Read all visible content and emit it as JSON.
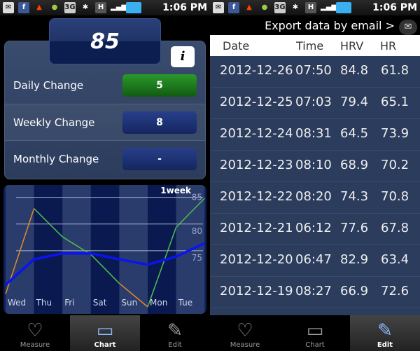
{
  "status_bar": {
    "time": "1:06 PM",
    "icons": [
      "voicemail-icon",
      "facebook-icon",
      "warning-icon",
      "android-icon",
      "3g-icon",
      "bluetooth-icon",
      "hspa-icon",
      "signal-icon",
      "battery-icon"
    ]
  },
  "left": {
    "hrv_value": "85",
    "info_label": "i",
    "rows": [
      {
        "label": "Daily Change",
        "value": "5",
        "color": "#1e7a1e"
      },
      {
        "label": "Weekly Change",
        "value": "8",
        "color": "#1d2f70"
      },
      {
        "label": "Monthly Change",
        "value": "-",
        "color": "#1d2f70"
      }
    ]
  },
  "chart_data": {
    "type": "line",
    "period_label": "1week",
    "categories": [
      "Wed",
      "Thu",
      "Fri",
      "Sat",
      "Sun",
      "Mon",
      "Tue",
      ""
    ],
    "y_ticks": [
      75,
      80,
      85
    ],
    "ylim": [
      64.5,
      86
    ],
    "grid": true,
    "series": [
      {
        "values": [
          66.9,
          82.9,
          77.6,
          74.3,
          68.9,
          64.5,
          79.4,
          84.8
        ],
        "color": "#4ec04e",
        "segment_colors": [
          "#e08a2a",
          "#4ec04e",
          "#4ec04e",
          "#4ec04e",
          "#e08a2a",
          "#4ec04e",
          "#4ec04e"
        ]
      },
      {
        "values": [
          68.6,
          73.4,
          74.5,
          74.5,
          73.4,
          72.4,
          73.9,
          76.4
        ],
        "color": "#0a14f0"
      }
    ]
  },
  "right": {
    "export_label": "Export data by email >",
    "columns": [
      "Date",
      "Time",
      "HRV",
      "HR"
    ],
    "rows": [
      [
        "2012-12-26",
        "07:50",
        "84.8",
        "61.8"
      ],
      [
        "2012-12-25",
        "07:03",
        "79.4",
        "65.1"
      ],
      [
        "2012-12-24",
        "08:31",
        "64.5",
        "73.9"
      ],
      [
        "2012-12-23",
        "08:10",
        "68.9",
        "70.2"
      ],
      [
        "2012-12-22",
        "08:20",
        "74.3",
        "70.8"
      ],
      [
        "2012-12-21",
        "06:12",
        "77.6",
        "67.8"
      ],
      [
        "2012-12-20",
        "06:47",
        "82.9",
        "63.4"
      ],
      [
        "2012-12-19",
        "08:27",
        "66.9",
        "72.6"
      ]
    ]
  },
  "nav": [
    {
      "label": "Measure",
      "icon": "heart-icon"
    },
    {
      "label": "Chart",
      "icon": "chart-icon"
    },
    {
      "label": "Edit",
      "icon": "pencil-icon"
    }
  ],
  "nav_active": {
    "left": "Chart",
    "right": "Edit"
  }
}
